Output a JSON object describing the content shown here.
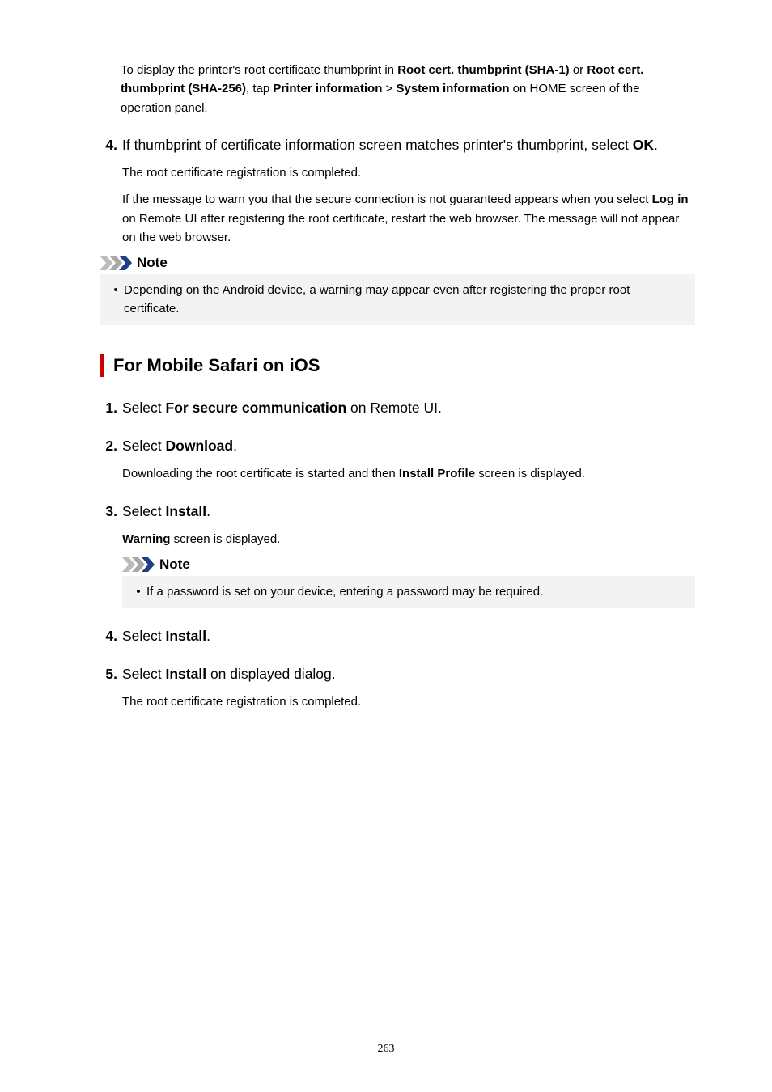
{
  "topParagraph": {
    "pre": "To display the printer's root certificate thumbprint in ",
    "b1": "Root cert. thumbprint (SHA-1)",
    "mid1": " or ",
    "b2": "Root cert. thumbprint (SHA-256)",
    "mid2": ", tap ",
    "b3": "Printer information",
    "mid3": " > ",
    "b4": "System information",
    "post": " on HOME screen of the operation panel."
  },
  "step4": {
    "num": "4.",
    "pre": "If thumbprint of certificate information screen matches printer's thumbprint, select ",
    "b1": "OK",
    "post": ".",
    "sub1": "The root certificate registration is completed.",
    "sub2pre": "If the message to warn you that the secure connection is not guaranteed appears when you select ",
    "sub2b": "Log in",
    "sub2post": " on Remote UI after registering the root certificate, restart the web browser. The message will not appear on the web browser."
  },
  "note1": {
    "label": "Note",
    "text": "Depending on the Android device, a warning may appear even after registering the proper root certificate."
  },
  "sectionHeading": "For Mobile Safari on iOS",
  "s1": {
    "num": "1.",
    "pre": "Select ",
    "b1": "For secure communication",
    "post": " on Remote UI."
  },
  "s2": {
    "num": "2.",
    "pre": "Select ",
    "b1": "Download",
    "post": ".",
    "subpre": "Downloading the root certificate is started and then ",
    "subb": "Install Profile",
    "subpost": " screen is displayed."
  },
  "s3": {
    "num": "3.",
    "pre": "Select ",
    "b1": "Install",
    "post": ".",
    "subb": "Warning",
    "subpost": " screen is displayed."
  },
  "note2": {
    "label": "Note",
    "text": "If a password is set on your device, entering a password may be required."
  },
  "s4": {
    "num": "4.",
    "pre": "Select ",
    "b1": "Install",
    "post": "."
  },
  "s5": {
    "num": "5.",
    "pre": "Select ",
    "b1": "Install",
    "post": " on displayed dialog.",
    "sub": "The root certificate registration is completed."
  },
  "pageNumber": "263",
  "bulletGlyph": "•"
}
